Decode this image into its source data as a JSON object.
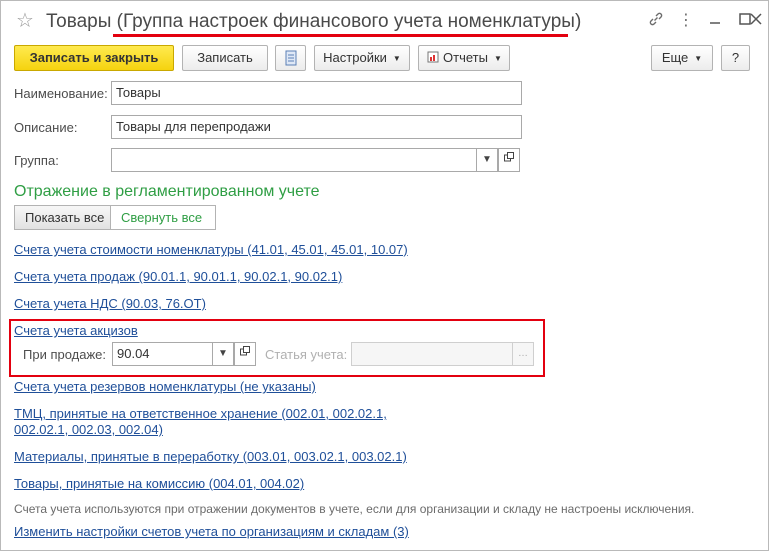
{
  "window": {
    "title": "Товары (Группа настроек финансового учета номенклатуры)",
    "star_icon": "star-icon",
    "controls": [
      "link-icon",
      "more-icon",
      "minimize-icon",
      "maximize-icon",
      "close-icon"
    ]
  },
  "toolbar": {
    "save_close_label": "Записать и закрыть",
    "save_label": "Записать",
    "settings_label": "Настройки",
    "reports_label": "Отчеты",
    "more_label": "Еще",
    "help_label": "?"
  },
  "form": {
    "name_label": "Наименование:",
    "name_value": "Товары",
    "description_label": "Описание:",
    "description_value": "Товары для перепродажи",
    "group_label": "Группа:",
    "group_value": ""
  },
  "section": {
    "title": "Отражение в регламентированном учете",
    "show_all_label": "Показать все",
    "collapse_all_label": "Свернуть все"
  },
  "links": {
    "cost_accounts": "Счета учета стоимости номенклатуры (41.01, 45.01, 45.01, 10.07)",
    "sales_accounts": "Счета учета продаж (90.01.1, 90.01.1, 90.02.1, 90.02.1)",
    "vat_accounts": "Счета учета НДС (90.03, 76.ОТ)",
    "excise_accounts": "Счета учета акцизов",
    "reserve_accounts": "Счета учета резервов номенклатуры (не указаны)",
    "custody_line1": "ТМЦ, принятые на ответственное хранение (002.01, 002.02.1,",
    "custody_line2": "002.02.1, 002.03, 002.04)",
    "processing_accounts": "Материалы, принятые в переработку (003.01, 003.02.1, 003.02.1)",
    "commission_accounts": "Товары, принятые на комиссию (004.01, 004.02)",
    "change_settings": "Изменить настройки счетов учета по организациям и складам (3)"
  },
  "excise": {
    "on_sale_label": "При продаже:",
    "on_sale_value": "90.04",
    "article_label": "Статья учета:",
    "article_value": ""
  },
  "note": "Счета учета используются при отражении документов в учете, если для организации и складу не настроены исключения.",
  "colors": {
    "primary_button": "#f5d30f",
    "section_title": "#2f9e44",
    "link": "#1f4f99",
    "highlight": "#e3000f"
  }
}
